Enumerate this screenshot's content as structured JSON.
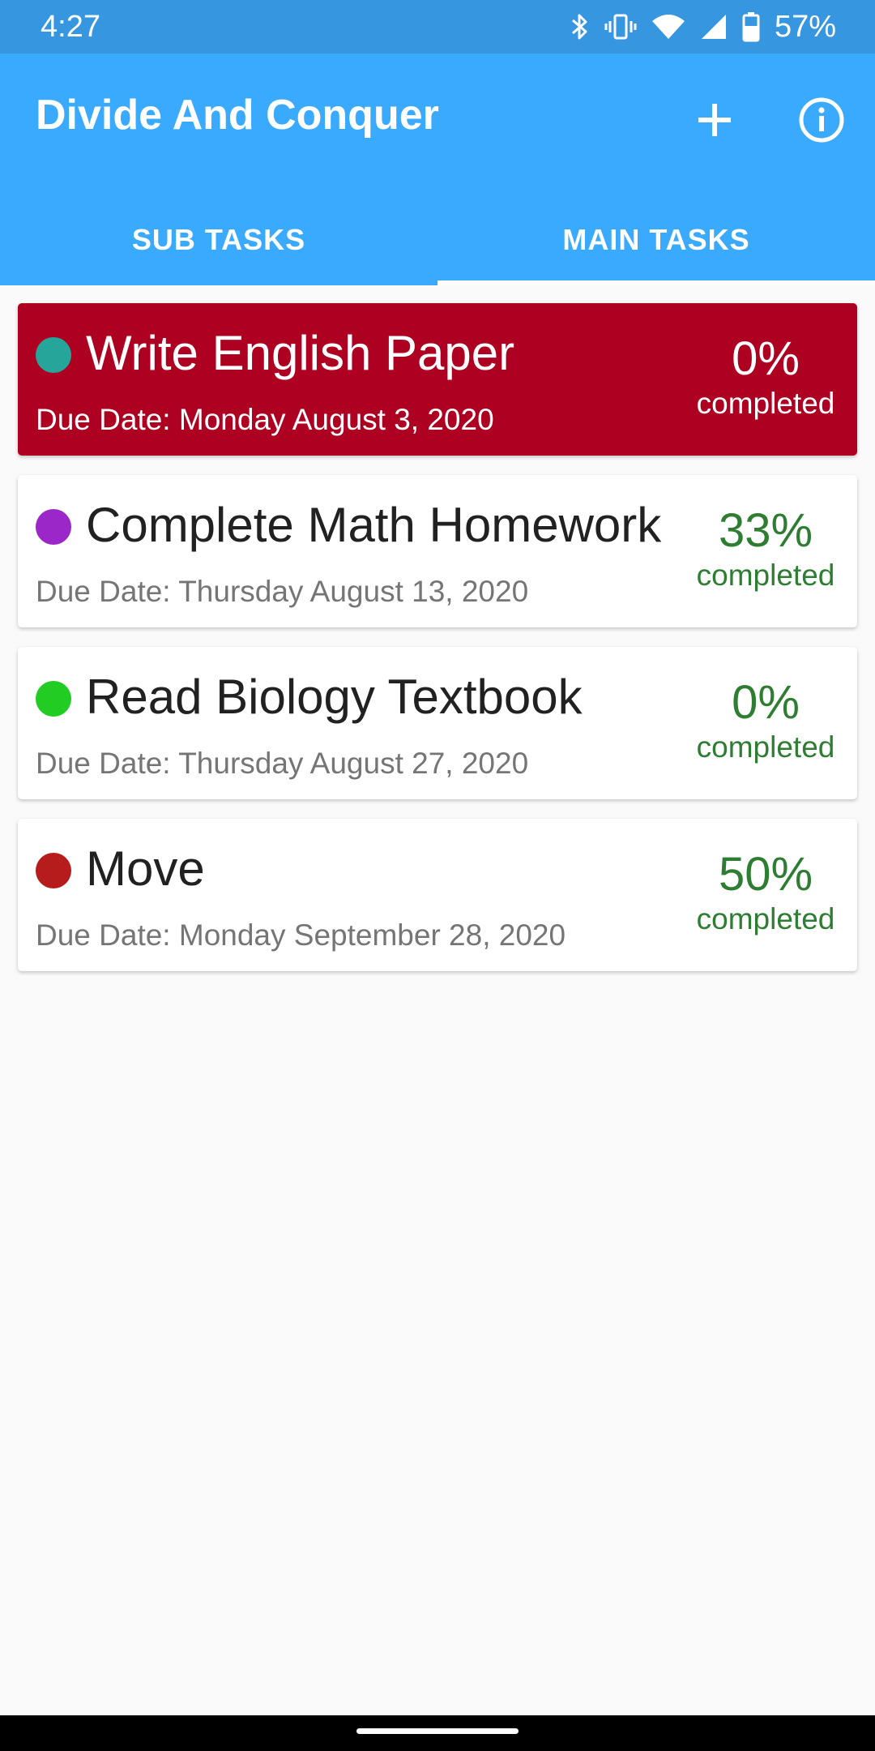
{
  "status_bar": {
    "time": "4:27",
    "battery": "57%",
    "icons": [
      "bluetooth-icon",
      "vibrate-icon",
      "wifi-icon",
      "cell-signal-icon",
      "battery-icon"
    ]
  },
  "app_bar": {
    "title": "Divide And Conquer",
    "add_icon": "plus-icon",
    "info_icon": "info-icon",
    "background": "#3AAAFF"
  },
  "tabs": [
    {
      "label": "SUB TASKS",
      "selected": false
    },
    {
      "label": "MAIN TASKS",
      "selected": true
    }
  ],
  "tasks": [
    {
      "title": "Write English Paper",
      "due_date": "Due Date: Monday August 3, 2020",
      "percent": "0%",
      "percent_label": "completed",
      "dot_color": "#26A69A",
      "card_color": "#AE0021",
      "overdue": true
    },
    {
      "title": "Complete Math Homework",
      "due_date": "Due Date: Thursday August 13, 2020",
      "percent": "33%",
      "percent_label": "completed",
      "dot_color": "#9C27C8",
      "card_color": "#FFFFFF",
      "overdue": false
    },
    {
      "title": "Read Biology Textbook",
      "due_date": "Due Date: Thursday August 27, 2020",
      "percent": "0%",
      "percent_label": "completed",
      "dot_color": "#22CC22",
      "card_color": "#FFFFFF",
      "overdue": false
    },
    {
      "title": "Move",
      "due_date": "Due Date: Monday September 28, 2020",
      "percent": "50%",
      "percent_label": "completed",
      "dot_color": "#B71C1C",
      "card_color": "#FFFFFF",
      "overdue": false
    }
  ],
  "colors": {
    "status_bar": "#3796E0",
    "progress_text": "#2E7D32",
    "background": "#FAFAFA"
  }
}
